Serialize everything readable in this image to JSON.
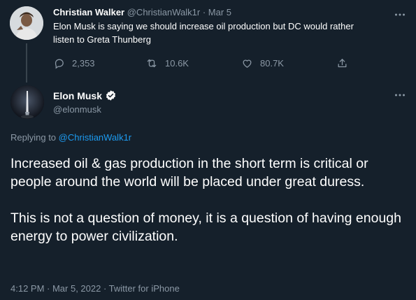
{
  "reply_tweet": {
    "author_name": "Christian Walker",
    "handle": "@ChristianWalk1r",
    "date": "· Mar 5",
    "text": "Elon Musk is saying we should increase oil production but DC would rather listen to Greta Thunberg",
    "replies": "2,353",
    "retweets": "10.6K",
    "likes": "80.7K"
  },
  "main_tweet": {
    "author_name": "Elon Musk",
    "handle": "@elonmusk",
    "replying_prefix": "Replying to",
    "replying_handle": "@ChristianWalk1r",
    "paragraph_1": "Increased oil & gas production in the short term is critical or people around the world will be placed under great duress.",
    "paragraph_2": "This is not a question of money, it is a question of having enough energy to power civilization.",
    "meta": "4:12 PM · Mar 5, 2022 · Twitter for iPhone"
  },
  "colors": {
    "background": "#15202b",
    "muted": "#8b98a5",
    "accent": "#1d9bf0",
    "thread_line": "#38444d"
  },
  "icons": [
    "more-icon",
    "reply-icon",
    "retweet-icon",
    "like-icon",
    "share-icon",
    "verified-badge-icon"
  ]
}
